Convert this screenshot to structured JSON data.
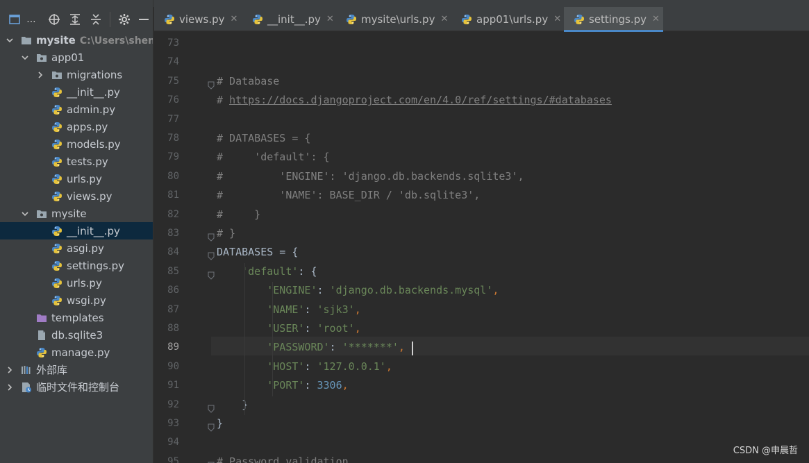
{
  "project_pane": {
    "title": "...",
    "tree": [
      {
        "label": "mysite",
        "hint": "C:\\Users\\shench",
        "depth": 0,
        "expanded": true,
        "kind": "folder",
        "bold": true
      },
      {
        "label": "app01",
        "depth": 1,
        "expanded": true,
        "kind": "package"
      },
      {
        "label": "migrations",
        "depth": 2,
        "expanded": false,
        "kind": "package"
      },
      {
        "label": "__init__.py",
        "depth": 2,
        "kind": "python"
      },
      {
        "label": "admin.py",
        "depth": 2,
        "kind": "python"
      },
      {
        "label": "apps.py",
        "depth": 2,
        "kind": "python"
      },
      {
        "label": "models.py",
        "depth": 2,
        "kind": "python"
      },
      {
        "label": "tests.py",
        "depth": 2,
        "kind": "python"
      },
      {
        "label": "urls.py",
        "depth": 2,
        "kind": "python"
      },
      {
        "label": "views.py",
        "depth": 2,
        "kind": "python"
      },
      {
        "label": "mysite",
        "depth": 1,
        "expanded": true,
        "kind": "package"
      },
      {
        "label": "__init__.py",
        "depth": 2,
        "kind": "python",
        "selected": true
      },
      {
        "label": "asgi.py",
        "depth": 2,
        "kind": "python"
      },
      {
        "label": "settings.py",
        "depth": 2,
        "kind": "python"
      },
      {
        "label": "urls.py",
        "depth": 2,
        "kind": "python"
      },
      {
        "label": "wsgi.py",
        "depth": 2,
        "kind": "python"
      },
      {
        "label": "templates",
        "depth": 1,
        "kind": "template-folder"
      },
      {
        "label": "db.sqlite3",
        "depth": 1,
        "kind": "database"
      },
      {
        "label": "manage.py",
        "depth": 1,
        "kind": "python"
      },
      {
        "label": "外部库",
        "depth": 0,
        "expanded": false,
        "kind": "library"
      },
      {
        "label": "临时文件和控制台",
        "depth": 0,
        "expanded": false,
        "kind": "scratch"
      }
    ]
  },
  "tabs": [
    {
      "label": "views.py",
      "active": false
    },
    {
      "label": "__init__.py",
      "active": false
    },
    {
      "label": "mysite\\urls.py",
      "active": false
    },
    {
      "label": "app01\\urls.py",
      "active": false
    },
    {
      "label": "settings.py",
      "active": true
    }
  ],
  "editor": {
    "current_line": 89,
    "lines": [
      {
        "n": "73",
        "tokens": []
      },
      {
        "n": "74",
        "tokens": []
      },
      {
        "n": "75",
        "tokens": [
          {
            "t": "# Database",
            "c": "com"
          }
        ]
      },
      {
        "n": "76",
        "tokens": [
          {
            "t": "# ",
            "c": "com"
          },
          {
            "t": "https://docs.djangoproject.com/en/4.0/ref/settings/#databases",
            "c": "link"
          }
        ]
      },
      {
        "n": "77",
        "tokens": []
      },
      {
        "n": "78",
        "tokens": [
          {
            "t": "# DATABASES = {",
            "c": "com"
          }
        ]
      },
      {
        "n": "79",
        "tokens": [
          {
            "t": "#     'default': {",
            "c": "com"
          }
        ]
      },
      {
        "n": "80",
        "tokens": [
          {
            "t": "#         'ENGINE': 'django.db.backends.sqlite3',",
            "c": "com"
          }
        ]
      },
      {
        "n": "81",
        "tokens": [
          {
            "t": "#         'NAME': BASE_DIR / 'db.sqlite3',",
            "c": "com"
          }
        ]
      },
      {
        "n": "82",
        "tokens": [
          {
            "t": "#     }",
            "c": "com"
          }
        ]
      },
      {
        "n": "83",
        "tokens": [
          {
            "t": "# }",
            "c": "com"
          }
        ]
      },
      {
        "n": "84",
        "tokens": [
          {
            "t": "DATABASES = {",
            "c": "def"
          }
        ]
      },
      {
        "n": "85",
        "tokens": [
          {
            "t": "    ",
            "c": "def"
          },
          {
            "t": "'default'",
            "c": "str"
          },
          {
            "t": ": {",
            "c": "def"
          }
        ]
      },
      {
        "n": "86",
        "tokens": [
          {
            "t": "        ",
            "c": "def"
          },
          {
            "t": "'ENGINE'",
            "c": "str"
          },
          {
            "t": ": ",
            "c": "def"
          },
          {
            "t": "'django.db.backends.mysql'",
            "c": "str"
          },
          {
            "t": ",",
            "c": "pun"
          }
        ]
      },
      {
        "n": "87",
        "tokens": [
          {
            "t": "        ",
            "c": "def"
          },
          {
            "t": "'NAME'",
            "c": "str"
          },
          {
            "t": ": ",
            "c": "def"
          },
          {
            "t": "'sjk3'",
            "c": "str"
          },
          {
            "t": ",",
            "c": "pun"
          }
        ]
      },
      {
        "n": "88",
        "tokens": [
          {
            "t": "        ",
            "c": "def"
          },
          {
            "t": "'USER'",
            "c": "str"
          },
          {
            "t": ": ",
            "c": "def"
          },
          {
            "t": "'root'",
            "c": "str"
          },
          {
            "t": ",",
            "c": "pun"
          }
        ]
      },
      {
        "n": "89",
        "tokens": [
          {
            "t": "        ",
            "c": "def"
          },
          {
            "t": "'PASSWORD'",
            "c": "str"
          },
          {
            "t": ": ",
            "c": "def"
          },
          {
            "t": "'*******",
            "c": "str"
          },
          {
            "t": "'",
            "c": "str"
          },
          {
            "t": ",",
            "c": "pun"
          }
        ]
      },
      {
        "n": "90",
        "tokens": [
          {
            "t": "        ",
            "c": "def"
          },
          {
            "t": "'HOST'",
            "c": "str"
          },
          {
            "t": ": ",
            "c": "def"
          },
          {
            "t": "'127.0.0.1'",
            "c": "str"
          },
          {
            "t": ",",
            "c": "pun"
          }
        ]
      },
      {
        "n": "91",
        "tokens": [
          {
            "t": "        ",
            "c": "def"
          },
          {
            "t": "'PORT'",
            "c": "str"
          },
          {
            "t": ": ",
            "c": "def"
          },
          {
            "t": "3306",
            "c": "num"
          },
          {
            "t": ",",
            "c": "pun"
          }
        ]
      },
      {
        "n": "92",
        "tokens": [
          {
            "t": "    }",
            "c": "def"
          }
        ]
      },
      {
        "n": "93",
        "tokens": [
          {
            "t": "}",
            "c": "def"
          }
        ]
      },
      {
        "n": "94",
        "tokens": []
      },
      {
        "n": "95",
        "tokens": [
          {
            "t": "# Password validation",
            "c": "com"
          }
        ]
      }
    ]
  },
  "watermark": "CSDN @申晨哲",
  "colors": {
    "accent": "#4a88c7",
    "selection": "#0d293e",
    "comment": "#808080",
    "string": "#6a8759",
    "number": "#6897bb",
    "punctuation": "#cc7832"
  }
}
